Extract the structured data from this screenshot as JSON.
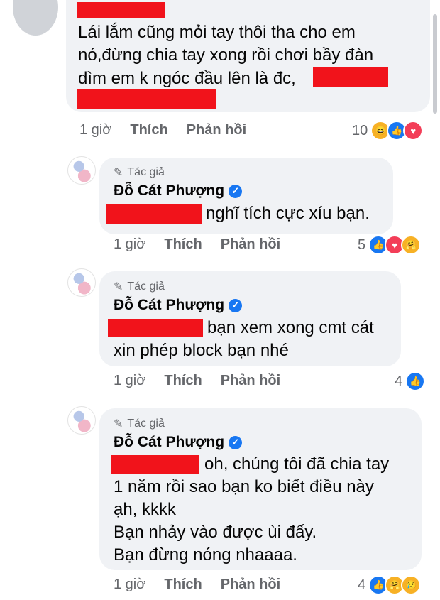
{
  "comments": [
    {
      "text_lines": [
        "Lái lắm cũng mỏi tay thôi tha cho em",
        "nó,đừng chia tay xong rồi chơi bầy đàn",
        "dìm em k ngóc đầu lên là đc,"
      ],
      "time": "1 giờ",
      "like_label": "Thích",
      "reply_label": "Phản hồi",
      "reaction_count": "10",
      "reaction_icons": [
        "haha-icon",
        "like-icon",
        "heart-icon"
      ]
    }
  ],
  "replies": [
    {
      "author_badge": "Tác giả",
      "author_name": "Đỗ Cát Phượng",
      "text_lines": [
        "nghĩ tích cực xíu bạn."
      ],
      "time": "1 giờ",
      "like_label": "Thích",
      "reply_label": "Phản hồi",
      "reaction_count": "5",
      "reaction_icons": [
        "like-icon",
        "heart-icon",
        "care-icon"
      ]
    },
    {
      "author_badge": "Tác giả",
      "author_name": "Đỗ Cát Phượng",
      "text_lines": [
        "bạn xem xong cmt cát",
        "xin phép block bạn nhé"
      ],
      "time": "1 giờ",
      "like_label": "Thích",
      "reply_label": "Phản hồi",
      "reaction_count": "4",
      "reaction_icons": [
        "like-icon"
      ]
    },
    {
      "author_badge": "Tác giả",
      "author_name": "Đỗ Cát Phượng",
      "text_lines": [
        "oh, chúng tôi đã chia tay",
        "1 năm rồi sao bạn ko biết điều này",
        "ạh, kkkk",
        "Bạn nhảy vào được ùi đấy.",
        "Bạn đừng nóng nhaaaa."
      ],
      "time": "1 giờ",
      "like_label": "Thích",
      "reply_label": "Phản hồi",
      "reaction_count": "4",
      "reaction_icons": [
        "like-icon",
        "care-icon",
        "sad-icon"
      ]
    }
  ],
  "colors": {
    "bubble": "#f0f2f5",
    "redaction": "#f1131b",
    "meta_text": "#65676b",
    "like_blue": "#1877f2",
    "heart_red": "#f33e58"
  }
}
